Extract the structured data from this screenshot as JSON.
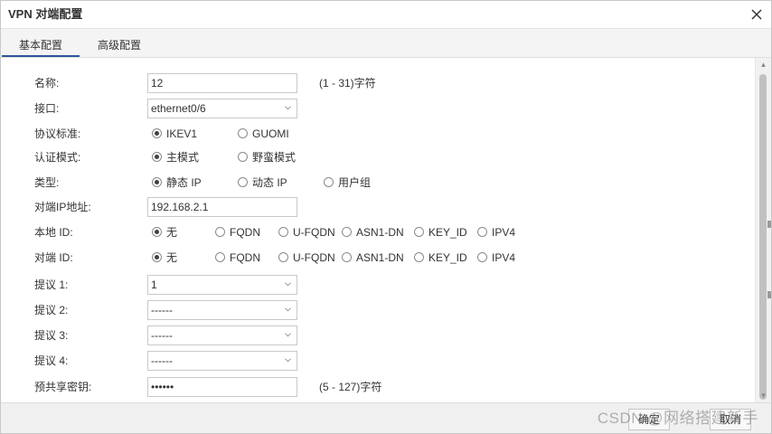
{
  "dialog": {
    "title": "VPN 对端配置",
    "close_icon": "close-icon"
  },
  "tabs": [
    {
      "label": "基本配置",
      "active": true
    },
    {
      "label": "高级配置",
      "active": false
    }
  ],
  "form": {
    "name": {
      "label": "名称:",
      "value": "12",
      "hint": "(1 - 31)字符"
    },
    "interface": {
      "label": "接口:",
      "value": "ethernet0/6"
    },
    "protocol": {
      "label": "协议标准:",
      "options": [
        "IKEV1",
        "GUOMI"
      ],
      "selected": "IKEV1"
    },
    "auth_mode": {
      "label": "认证模式:",
      "options": [
        "主模式",
        "野蛮模式"
      ],
      "selected": "主模式"
    },
    "type": {
      "label": "类型:",
      "options": [
        "静态 IP",
        "动态 IP",
        "用户组"
      ],
      "selected": "静态 IP"
    },
    "peer_ip": {
      "label": "对端IP地址:",
      "value": "192.168.2.1"
    },
    "local_id": {
      "label": "本地 ID:",
      "options": [
        "无",
        "FQDN",
        "U-FQDN",
        "ASN1-DN",
        "KEY_ID",
        "IPV4"
      ],
      "selected": "无"
    },
    "peer_id": {
      "label": "对端 ID:",
      "options": [
        "无",
        "FQDN",
        "U-FQDN",
        "ASN1-DN",
        "KEY_ID",
        "IPV4"
      ],
      "selected": "无"
    },
    "proposal1": {
      "label": "提议 1:",
      "value": "1"
    },
    "proposal2": {
      "label": "提议 2:",
      "value": "------"
    },
    "proposal3": {
      "label": "提议 3:",
      "value": "------"
    },
    "proposal4": {
      "label": "提议 4:",
      "value": "------"
    },
    "psk": {
      "label": "预共享密钥:",
      "value": "••••••",
      "hint": "(5 - 127)字符"
    }
  },
  "footer": {
    "ok_label": "确定",
    "cancel_label": "取消"
  },
  "watermark": "CSDN @网络搭建新手",
  "colors": {
    "tab_accent": "#2b579a",
    "border": "#c9c9c9",
    "footer_bg": "#f0f0f0"
  }
}
